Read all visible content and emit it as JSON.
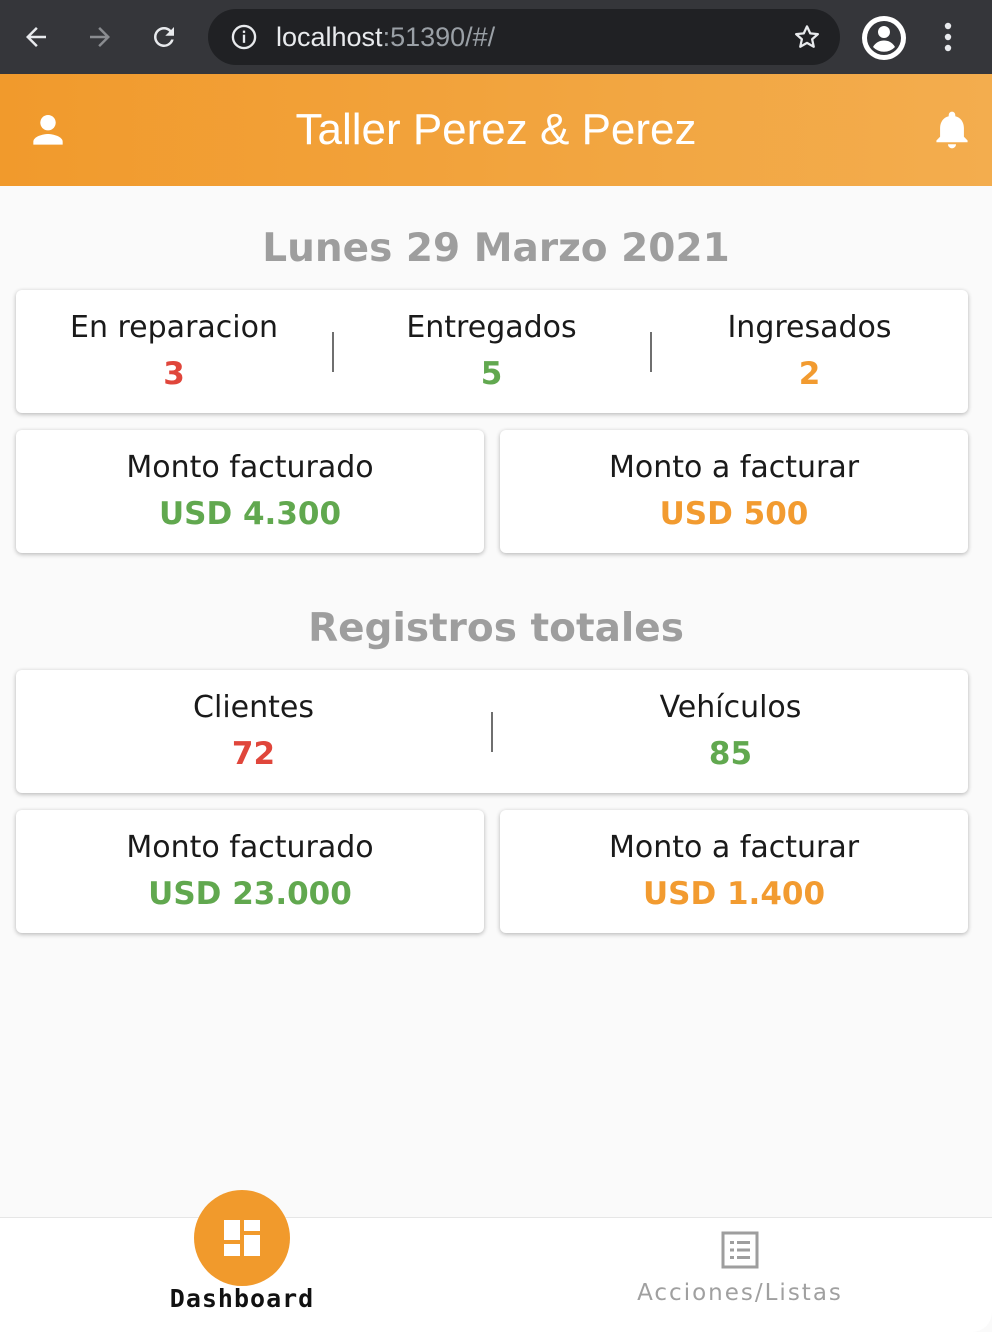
{
  "browser": {
    "url_host": "localhost",
    "url_rest": ":51390/#/"
  },
  "app_bar": {
    "title": "Taller Perez & Perez"
  },
  "today": {
    "title": "Lunes 29 Marzo 2021",
    "status": [
      {
        "label": "En reparacion",
        "value": "3",
        "color": "#e0463b"
      },
      {
        "label": "Entregados",
        "value": "5",
        "color": "#61a84f"
      },
      {
        "label": "Ingresados",
        "value": "2",
        "color": "#f29b30"
      }
    ],
    "billed": {
      "label": "Monto facturado",
      "value": "USD 4.300",
      "color": "#61a84f"
    },
    "to_bill": {
      "label": "Monto a facturar",
      "value": "USD 500",
      "color": "#f29b30"
    }
  },
  "totals": {
    "title": "Registros totales",
    "counts": [
      {
        "label": "Clientes",
        "value": "72",
        "color": "#e0463b"
      },
      {
        "label": "Vehículos",
        "value": "85",
        "color": "#61a84f"
      }
    ],
    "billed": {
      "label": "Monto facturado",
      "value": "USD 23.000",
      "color": "#61a84f"
    },
    "to_bill": {
      "label": "Monto a facturar",
      "value": "USD 1.400",
      "color": "#f29b30"
    }
  },
  "bottom_nav": {
    "items": [
      {
        "label": "Dashboard",
        "icon": "dashboard-icon",
        "active": true
      },
      {
        "label": "Acciones/Listas",
        "icon": "list-icon",
        "active": false
      }
    ]
  },
  "colors": {
    "accent": "#f19a2c",
    "red": "#e0463b",
    "green": "#61a84f",
    "orange": "#f29b30"
  }
}
